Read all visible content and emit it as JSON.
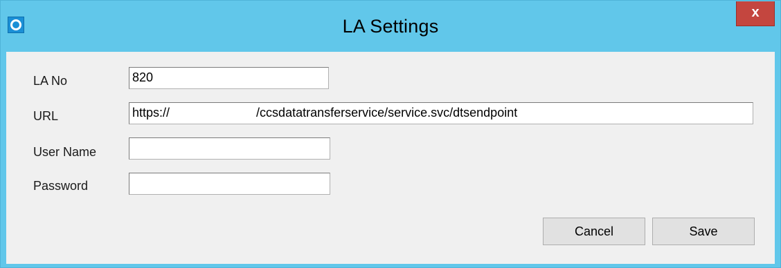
{
  "window": {
    "title": "LA Settings",
    "close_glyph": "x",
    "icon": "app-icon"
  },
  "form": {
    "la_no": {
      "label": "LA No",
      "value": "820"
    },
    "url": {
      "label": "URL",
      "value": "https://                         /ccsdatatransferservice/service.svc/dtsendpoint"
    },
    "user_name": {
      "label": "User Name",
      "value": ""
    },
    "password": {
      "label": "Password",
      "value": ""
    }
  },
  "buttons": {
    "cancel_label": "Cancel",
    "save_label": "Save"
  },
  "colors": {
    "titlebar": "#61c7ea",
    "close_button": "#c4463f",
    "client_background": "#f0f0f0"
  }
}
